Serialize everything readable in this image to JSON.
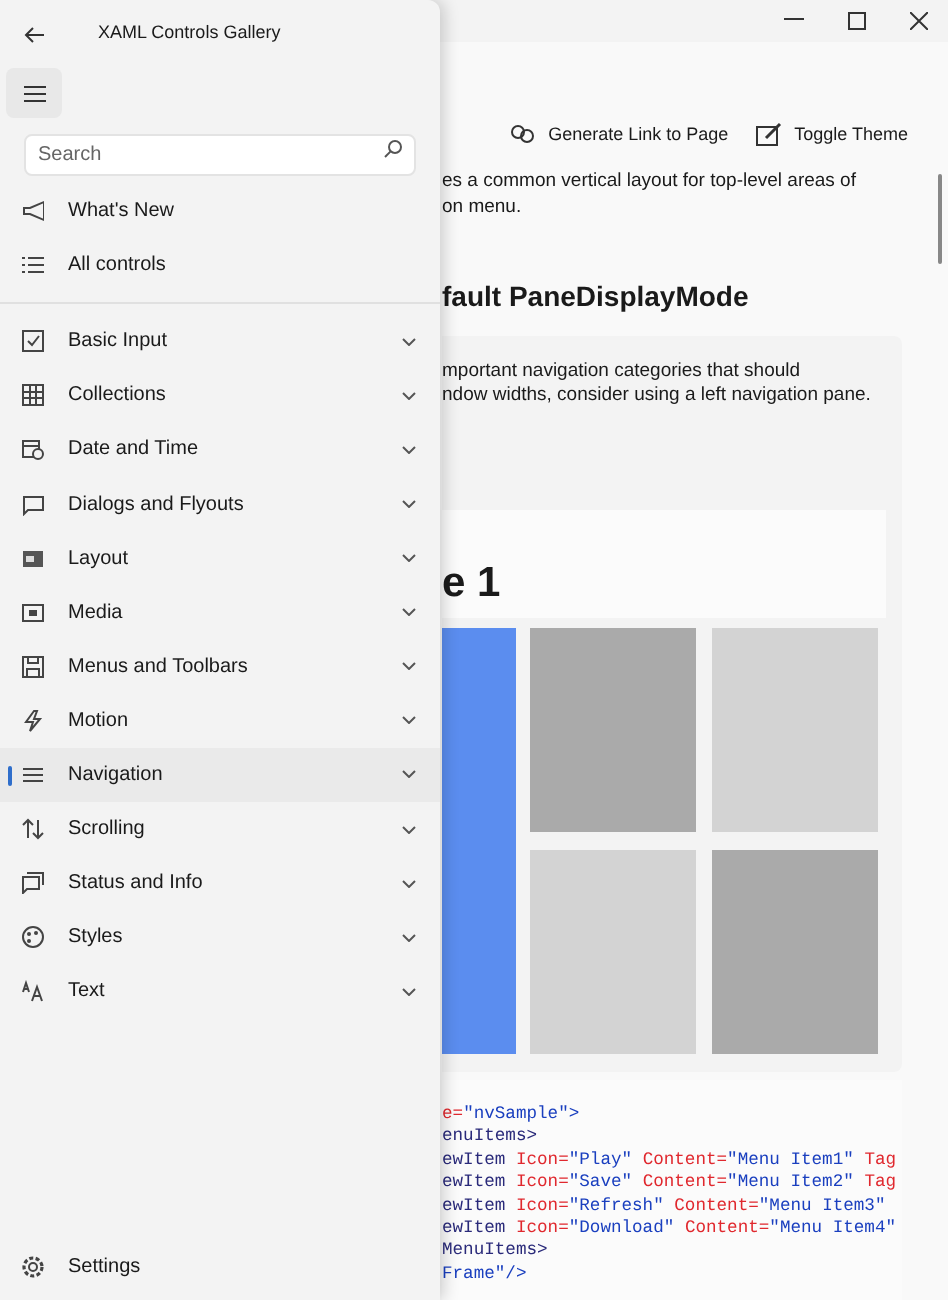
{
  "window": {
    "title": "XAML Controls Gallery"
  },
  "pane": {
    "search": {
      "placeholder": "Search"
    },
    "top_items": [
      {
        "label": "What's New",
        "selected": false
      },
      {
        "label": "All controls",
        "selected": false
      }
    ],
    "categories": [
      {
        "label": "Basic Input",
        "selected": false,
        "expanded": false
      },
      {
        "label": "Collections",
        "selected": false,
        "expanded": false
      },
      {
        "label": "Date and Time",
        "selected": false,
        "expanded": false
      },
      {
        "label": "Dialogs and Flyouts",
        "selected": false,
        "expanded": false
      },
      {
        "label": "Layout",
        "selected": false,
        "expanded": false
      },
      {
        "label": "Media",
        "selected": false,
        "expanded": false
      },
      {
        "label": "Menus and Toolbars",
        "selected": false,
        "expanded": false
      },
      {
        "label": "Motion",
        "selected": false,
        "expanded": false
      },
      {
        "label": "Navigation",
        "selected": true,
        "expanded": false
      },
      {
        "label": "Scrolling",
        "selected": false,
        "expanded": false
      },
      {
        "label": "Status and Info",
        "selected": false,
        "expanded": false
      },
      {
        "label": "Styles",
        "selected": false,
        "expanded": false
      },
      {
        "label": "Text",
        "selected": false,
        "expanded": false
      }
    ],
    "footer_item": {
      "label": "Settings",
      "selected": false
    }
  },
  "toolbar": [
    "Generate Link to Page",
    "Toggle Theme"
  ],
  "description": [
    "es a common vertical layout for top-level areas of",
    "on menu."
  ],
  "section": {
    "heading": "fault PaneDisplayMode",
    "text": [
      "mportant navigation categories that should",
      "ndow widths, consider using a left navigation pane."
    ],
    "sample_heading": "e 1",
    "code": [
      [
        {
          "kind": "attr",
          "text": "e="
        },
        {
          "kind": "value",
          "text": "\"nvSample\""
        },
        {
          "kind": "value",
          "text": ">"
        }
      ],
      [
        {
          "kind": "tag",
          "text": "enuItems>"
        }
      ],
      [
        {
          "kind": "tag",
          "text": "ewItem "
        },
        {
          "kind": "attr",
          "text": "Icon="
        },
        {
          "kind": "value",
          "text": "\"Play\" "
        },
        {
          "kind": "attr",
          "text": "Content="
        },
        {
          "kind": "value",
          "text": "\"Menu Item1\" "
        },
        {
          "kind": "attr",
          "text": "Tag"
        }
      ],
      [
        {
          "kind": "tag",
          "text": "ewItem "
        },
        {
          "kind": "attr",
          "text": "Icon="
        },
        {
          "kind": "value",
          "text": "\"Save\" "
        },
        {
          "kind": "attr",
          "text": "Content="
        },
        {
          "kind": "value",
          "text": "\"Menu Item2\" "
        },
        {
          "kind": "attr",
          "text": "Tag"
        }
      ],
      [
        {
          "kind": "tag",
          "text": "ewItem "
        },
        {
          "kind": "attr",
          "text": "Icon="
        },
        {
          "kind": "value",
          "text": "\"Refresh\" "
        },
        {
          "kind": "attr",
          "text": "Content="
        },
        {
          "kind": "value",
          "text": "\"Menu Item3\""
        }
      ],
      [
        {
          "kind": "tag",
          "text": "ewItem "
        },
        {
          "kind": "attr",
          "text": "Icon="
        },
        {
          "kind": "value",
          "text": "\"Download\" "
        },
        {
          "kind": "attr",
          "text": "Content="
        },
        {
          "kind": "value",
          "text": "\"Menu Item4\""
        }
      ],
      [
        {
          "kind": "tag",
          "text": "MenuItems>"
        }
      ],
      [
        {
          "kind": "value",
          "text": "Frame\"/>"
        }
      ]
    ]
  }
}
